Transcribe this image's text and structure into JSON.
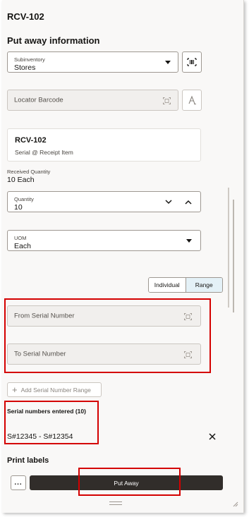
{
  "header": {
    "title": "RCV-102"
  },
  "putaway": {
    "section_title": "Put away information",
    "subinventory": {
      "label": "Subinventory",
      "value": "Stores"
    },
    "locator": {
      "placeholder": "Locator Barcode"
    }
  },
  "item_card": {
    "title": "RCV-102",
    "subtitle": "Serial @ Receipt Item"
  },
  "received": {
    "label": "Received Quantity",
    "value": "10 Each"
  },
  "quantity": {
    "label": "Quantity",
    "value": "10"
  },
  "uom": {
    "label": "UOM",
    "value": "Each"
  },
  "mode_toggle": {
    "individual": "Individual",
    "range": "Range",
    "selected": "Range"
  },
  "serial_range": {
    "from_placeholder": "From Serial Number",
    "to_placeholder": "To Serial Number"
  },
  "add_range_label": "Add Serial Number Range",
  "serials_entered": {
    "title": "Serial numbers entered (10)",
    "value": "S#12345 - S#12354"
  },
  "print": {
    "title": "Print labels",
    "more_label": "...",
    "put_away_label": "Put Away"
  },
  "colors": {
    "highlight": "#d40000",
    "primary_button": "#312d2a",
    "selected_toggle": "#e4f1f7"
  }
}
